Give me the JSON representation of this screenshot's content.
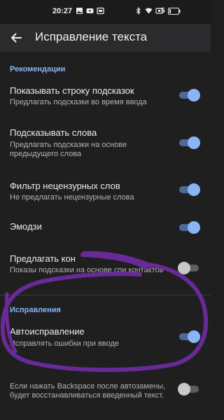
{
  "status_bar": {
    "time": "20:27",
    "battery": "5",
    "left_icons": [
      "gallery-icon",
      "youtube-icon",
      "map-icon"
    ],
    "right_icons": [
      "bluetooth-icon",
      "wifi-icon",
      "sim-icon"
    ]
  },
  "app_bar": {
    "back_icon": "arrow-left-icon",
    "title": "Исправление текста"
  },
  "sections": {
    "recommendations": "Рекомендации",
    "corrections": "Исправления"
  },
  "settings": [
    {
      "title": "Показывать строку подсказок",
      "summary": "Предлагать подсказки во время ввода",
      "enabled": true
    },
    {
      "title": "Подсказывать слова",
      "summary": "Предлагать подсказки на основе предыдущего слова",
      "enabled": true
    },
    {
      "title": "Фильтр нецензурных слов",
      "summary": "Не предлагать нецензурные слова",
      "enabled": true
    },
    {
      "title": "Эмодзи",
      "summary": "",
      "enabled": true
    },
    {
      "title": "Предлагать кон",
      "summary": "Показы подсказки на основе спи контактов",
      "enabled": false
    },
    {
      "title": "Автоисправление",
      "summary": "Исправлять ошибки при вводе",
      "enabled": true
    },
    {
      "title": "",
      "summary": "Если нажать Backspace после автозамены, будет восстанавливаться введенный текст.",
      "enabled": false
    }
  ],
  "colors": {
    "accent": "#8ab4f8",
    "annotation": "#6a2a9a",
    "background": "#1f1f20"
  }
}
